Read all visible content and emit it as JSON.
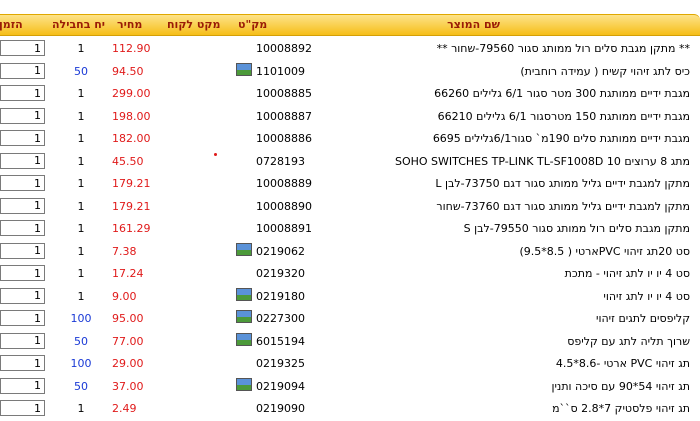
{
  "header": {
    "name": "שם המוצר",
    "sku": "מק\"ט",
    "customer_sku": "מקט לקוח",
    "price": "מחיר",
    "pack_unit": "יח בחבילה",
    "order_qty": "הזמן"
  },
  "rows": [
    {
      "name": "** מתקן מגבת סלים רול ממותג סגור 79560-שחור **",
      "sku": "10008892",
      "has_image": false,
      "price": "112.90",
      "pack": "1",
      "pack_highlight": false,
      "qty": "1"
    },
    {
      "name": "כיס לתג זיהוי קשיח ( עמידה רוחבית)",
      "sku": "1101009",
      "has_image": true,
      "price": "94.50",
      "pack": "50",
      "pack_highlight": true,
      "qty": "1"
    },
    {
      "name": "מגבת ידיים ממותגת 300 מטר סגור 6/1 גלילים   66260",
      "sku": "10008885",
      "has_image": false,
      "price": "299.00",
      "pack": "1",
      "pack_highlight": false,
      "qty": "1"
    },
    {
      "name": "מגבת ידיים ממותגת 150 מטרסגור 6/1 גלילים   66210",
      "sku": "10008887",
      "has_image": false,
      "price": "198.00",
      "pack": "1",
      "pack_highlight": false,
      "qty": "1"
    },
    {
      "name": "מגבת ידיים ממותגת סלים 190מ` סגור6/1גלילים 6695",
      "sku": "10008886",
      "has_image": false,
      "price": "182.00",
      "pack": "1",
      "pack_highlight": false,
      "qty": "1"
    },
    {
      "name": "מתג 8 ערוצים SOHO SWITCHES TP-LINK TL-SF1008D 10",
      "sku": "0728193",
      "has_image": false,
      "price": "45.50",
      "pack": "1",
      "pack_highlight": false,
      "qty": "1"
    },
    {
      "name": "מתקן למגבת ידיים גליל ממותג סגור דגם 73750-לבן L",
      "sku": "10008889",
      "has_image": false,
      "price": "179.21",
      "pack": "1",
      "pack_highlight": false,
      "qty": "1"
    },
    {
      "name": "מתקן למגבת ידיים גליל ממותג סגור דגם 73760-שחור",
      "sku": "10008890",
      "has_image": false,
      "price": "179.21",
      "pack": "1",
      "pack_highlight": false,
      "qty": "1"
    },
    {
      "name": "מתקן מגבת סלים רול ממותג סגור 79550-לבן S",
      "sku": "10008891",
      "has_image": false,
      "price": "161.29",
      "pack": "1",
      "pack_highlight": false,
      "qty": "1"
    },
    {
      "name": "סט 20תג זיהוי PVCארטי ( 8.5*9.5)",
      "sku": "0219062",
      "has_image": true,
      "price": "7.38",
      "pack": "1",
      "pack_highlight": false,
      "qty": "1"
    },
    {
      "name": "סט 4 יו יו לתג זיהוי - מתכת",
      "sku": "0219320",
      "has_image": false,
      "price": "17.24",
      "pack": "1",
      "pack_highlight": false,
      "qty": "1"
    },
    {
      "name": "סט 4 יו יו לתג זיהוי",
      "sku": "0219180",
      "has_image": true,
      "price": "9.00",
      "pack": "1",
      "pack_highlight": false,
      "qty": "1"
    },
    {
      "name": "קליפסים לתגים זיהוי",
      "sku": "0227300",
      "has_image": true,
      "price": "95.00",
      "pack": "100",
      "pack_highlight": true,
      "qty": "1"
    },
    {
      "name": "שרוך תליה לתג עם קליפס",
      "sku": "6015194",
      "has_image": true,
      "price": "77.00",
      "pack": "50",
      "pack_highlight": true,
      "qty": "1"
    },
    {
      "name": "תג זיהוי PVC ארטי -8.6*4.5",
      "sku": "0219325",
      "has_image": false,
      "price": "29.00",
      "pack": "100",
      "pack_highlight": true,
      "qty": "1"
    },
    {
      "name": "תג זיהוי 54*90 עם סיכה ותנין",
      "sku": "0219094",
      "has_image": true,
      "price": "37.00",
      "pack": "50",
      "pack_highlight": true,
      "qty": "1"
    },
    {
      "name": "תג זיהוי פלסטיק 7*2.8 ס``מ",
      "sku": "0219090",
      "has_image": false,
      "price": "2.49",
      "pack": "1",
      "pack_highlight": false,
      "qty": "1"
    }
  ]
}
